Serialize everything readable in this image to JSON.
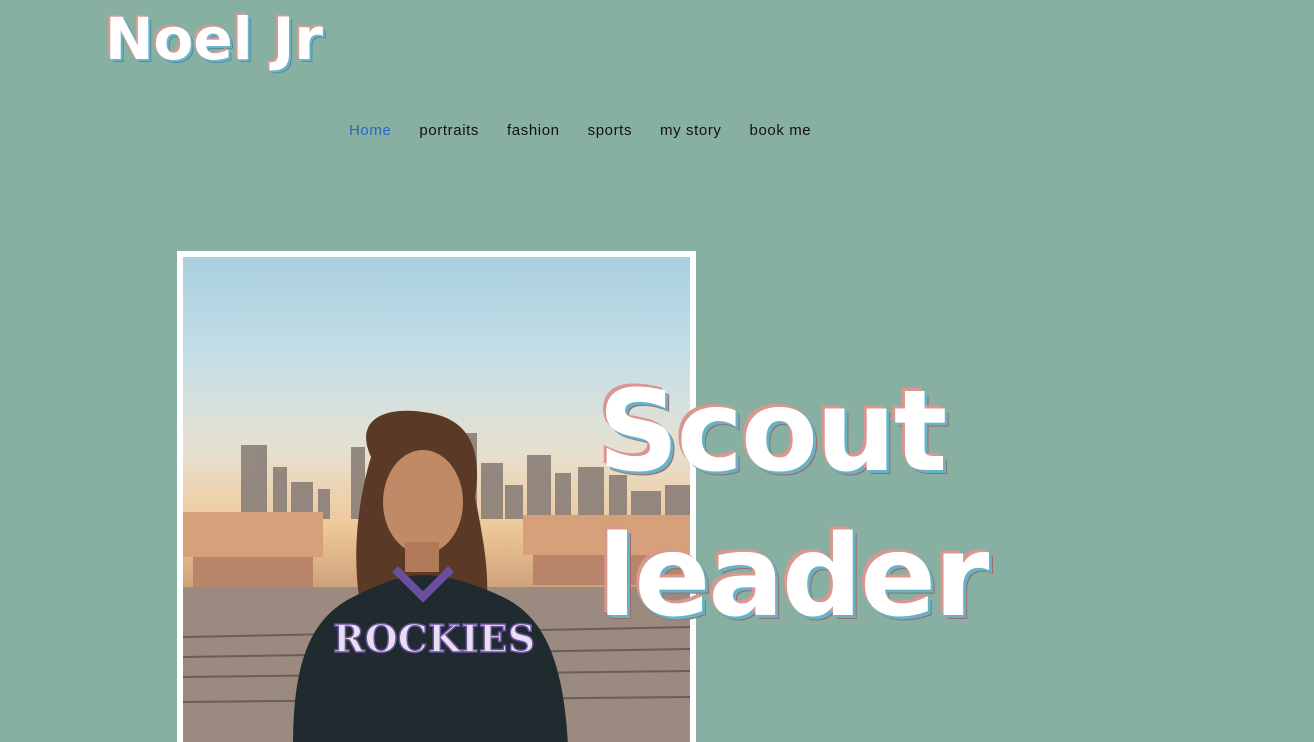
{
  "site": {
    "title": "Noel Jr"
  },
  "nav": {
    "items": [
      {
        "label": "Home",
        "active": true
      },
      {
        "label": "portraits",
        "active": false
      },
      {
        "label": "fashion",
        "active": false
      },
      {
        "label": "sports",
        "active": false
      },
      {
        "label": "my story",
        "active": false
      },
      {
        "label": "book me",
        "active": false
      }
    ]
  },
  "hero": {
    "headline_line1": "Scout",
    "headline_line2": "leader",
    "photo": {
      "description_icon": "portrait-photo",
      "jacket_text": "ROCKIES"
    }
  },
  "colors": {
    "background": "#88b0a2",
    "nav_active": "#2b66c4",
    "text_shadow_pink": "#d89790",
    "text_shadow_blue": "#67b2c6"
  }
}
